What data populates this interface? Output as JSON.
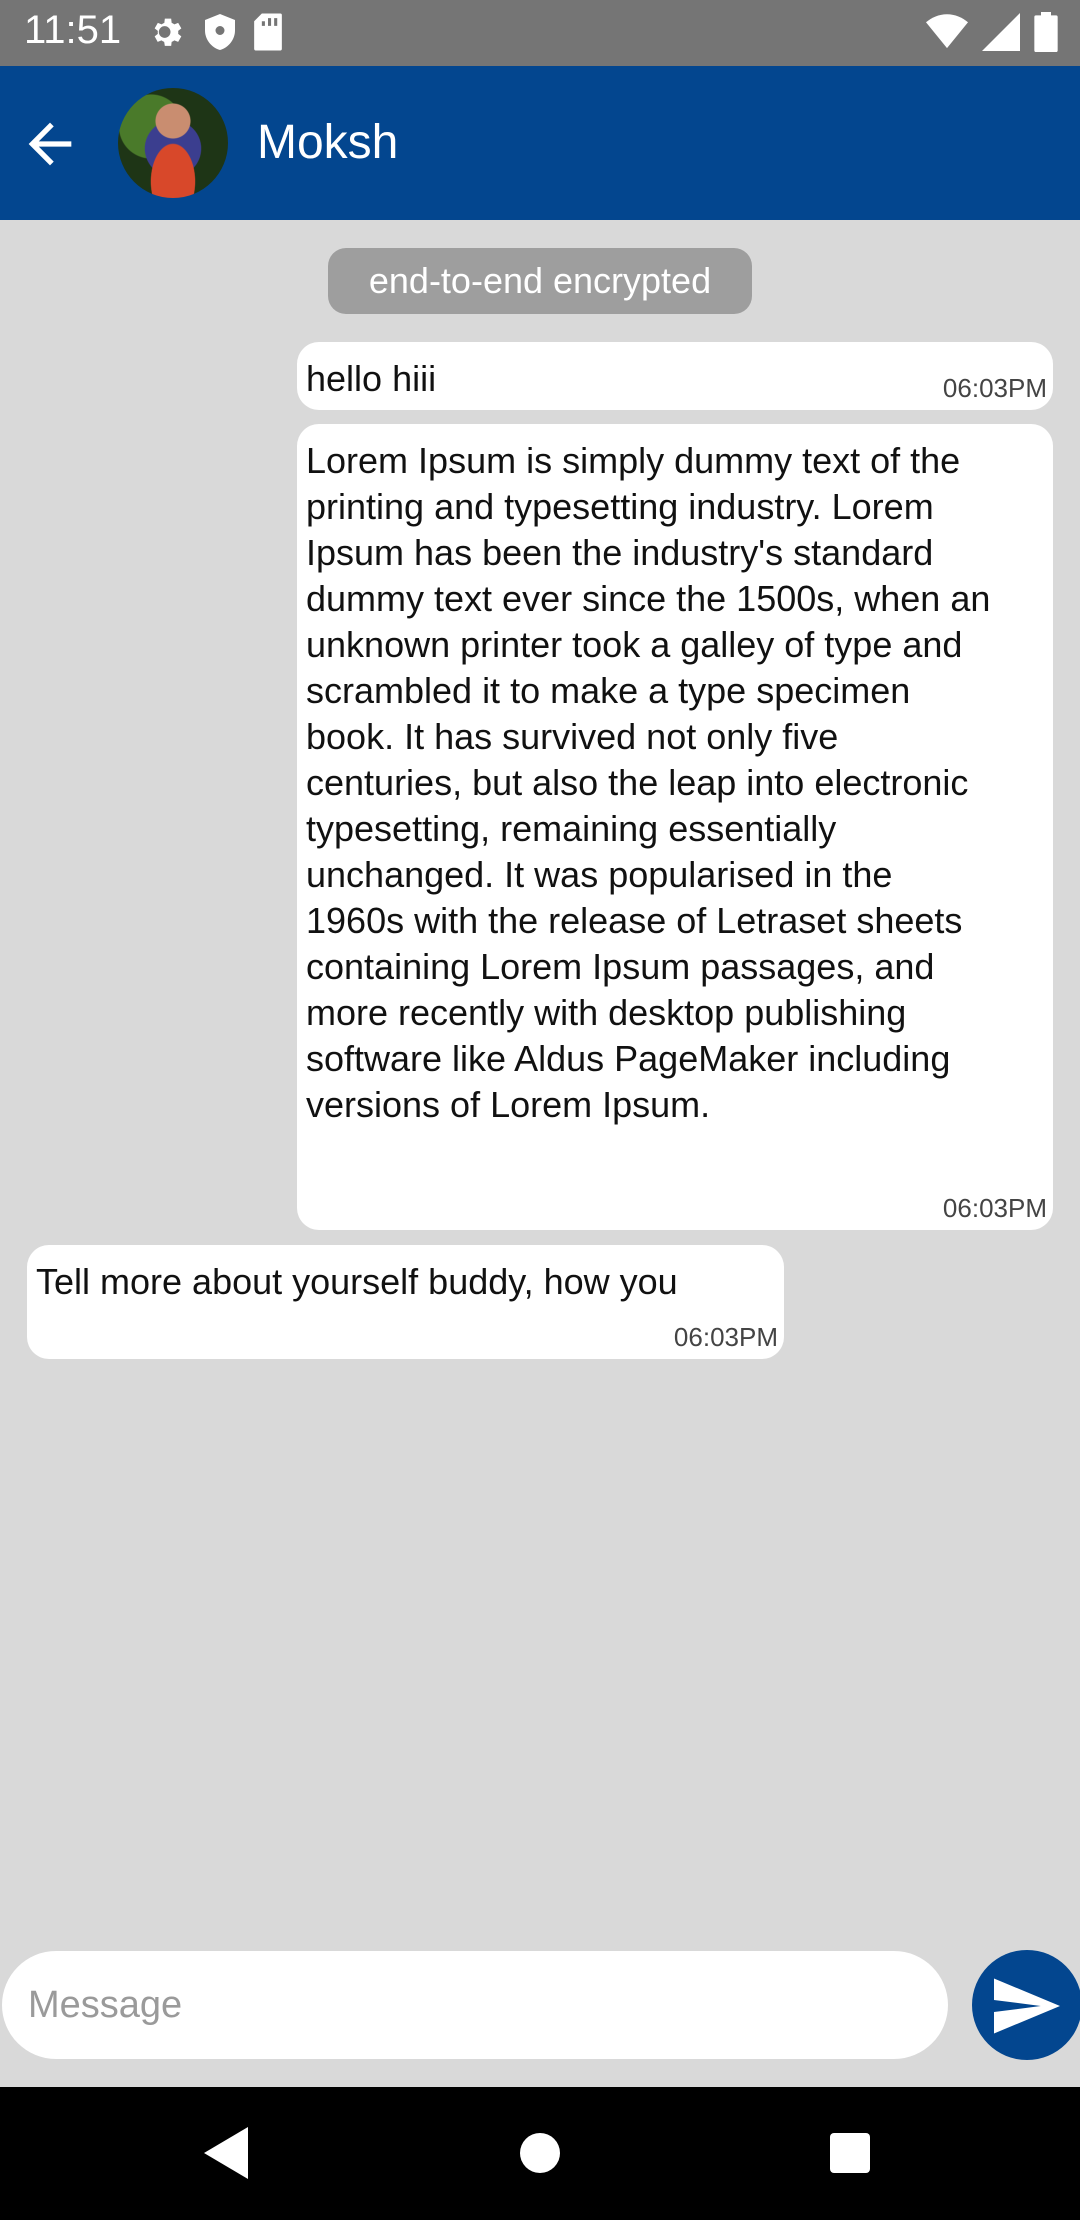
{
  "status_bar": {
    "time": "11:51",
    "left_icons": [
      "gear-icon",
      "shield-icon",
      "sd-card-icon"
    ],
    "right_icons": [
      "wifi-icon",
      "signal-icon",
      "battery-icon"
    ]
  },
  "header": {
    "contact_name": "Moksh",
    "color": "#03468f"
  },
  "chat": {
    "encryption_notice": "end-to-end encrypted",
    "messages": [
      {
        "direction": "outgoing",
        "text": "hello hiii",
        "time": "06:03PM"
      },
      {
        "direction": "outgoing",
        "text": "Lorem Ipsum is simply dummy text of the printing and typesetting industry. Lorem Ipsum has been the industry's standard dummy text ever since the 1500s, when an unknown printer took a galley of type and scrambled it to make a type specimen book. It has survived not only five centuries, but also the leap into electronic typesetting, remaining essentially unchanged. It was popularised in the 1960s with the release of Letraset sheets containing Lorem Ipsum passages, and more recently with desktop publishing software like Aldus PageMaker including versions of Lorem Ipsum.",
        "time": "06:03PM"
      },
      {
        "direction": "incoming",
        "text": "Tell more about yourself buddy, how you",
        "time": "06:03PM"
      }
    ]
  },
  "composer": {
    "placeholder": "Message",
    "value": "",
    "send_icon": "send-icon"
  },
  "nav_bar": {
    "icons": [
      "back-triangle-icon",
      "home-circle-icon",
      "recents-square-icon"
    ]
  }
}
